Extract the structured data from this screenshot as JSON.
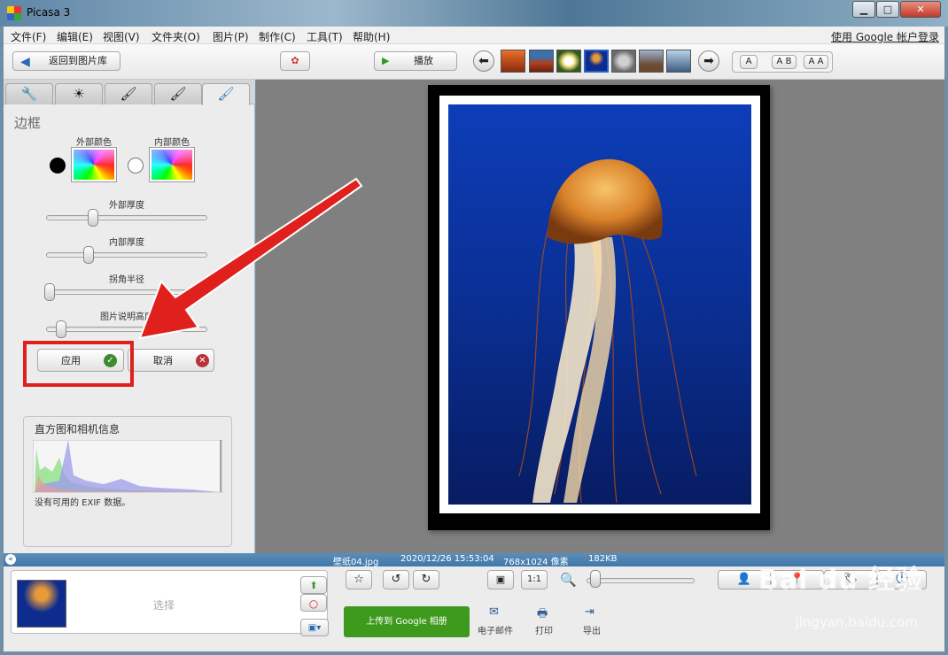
{
  "window": {
    "title": "Picasa 3",
    "minimize": "▁",
    "maximize": "□",
    "close": "✕"
  },
  "menu": [
    "文件(F)",
    "编辑(E)",
    "视图(V)",
    "文件夹(O)",
    "图片(P)",
    "制作(C)",
    "工具(T)",
    "帮助(H)"
  ],
  "signin": "使用 Google 帐户登录",
  "toolbar": {
    "back_label": "返回到图片库",
    "play_label": "播放",
    "layout_a": "A",
    "layout_ab": "A B",
    "layout_aa": "A A"
  },
  "thumbnails": [
    "desert-sunset",
    "canyon",
    "flower",
    "jellyfish",
    "koala",
    "lighthouse",
    "penguins"
  ],
  "panel": {
    "title": "边框",
    "outer_color_label": "外部颜色",
    "inner_color_label": "内部颜色",
    "outer_thickness_label": "外部厚度",
    "inner_thickness_label": "内部厚度",
    "corner_radius_label": "拐角半径",
    "caption_height_label": "图片说明高度",
    "apply_label": "应用",
    "cancel_label": "取消",
    "outer_thickness": 0.3,
    "inner_thickness": 0.27,
    "corner_radius": 0.0,
    "caption_height": 0.07
  },
  "histogram": {
    "title": "直方图和相机信息",
    "note": "没有可用的 EXIF 数据。"
  },
  "status": {
    "filename": "壁纸04.jpg",
    "datetime": "2020/12/26 15:53:04",
    "dimensions": "768x1024 像素",
    "size": "182KB"
  },
  "tray": {
    "select_label": "选择",
    "upload_label": "上传到 Google 相册",
    "email_label": "电子邮件",
    "print_label": "打印",
    "export_label": "导出",
    "zoom_1to1": "1:1"
  },
  "watermark": {
    "main": "Bai du 经验",
    "sub": "jingyan.baidu.com"
  },
  "colors": {
    "upload_green": "#3e9a1c",
    "status_blue": "#4a82b2",
    "annotation_red": "#e0201c"
  }
}
